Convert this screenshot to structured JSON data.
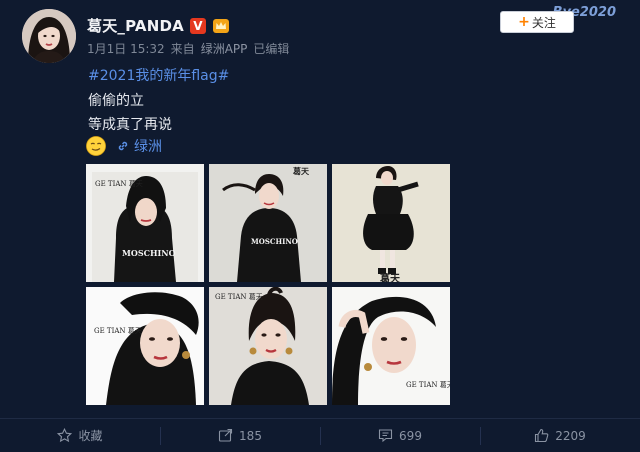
{
  "post": {
    "username": "葛天_PANDA",
    "vip_badge": "V",
    "meta": {
      "time": "1月1日 15:32",
      "source_prefix": "来自",
      "source": "绿洲APP",
      "edited": "已编辑"
    },
    "follow_label": "关注",
    "corner_deco_text": "Bye2020",
    "hashtag": "#2021我的新年flag#",
    "lines": [
      "偷偷的立",
      "等成真了再说"
    ],
    "link_label": "绿洲",
    "photos": [
      {
        "caption": "GE TIAN 葛天",
        "shirt": "MOSCHINO"
      },
      {
        "caption": "葛天",
        "shirt": "MOSCHINO"
      },
      {
        "caption": "葛天",
        "shirt": ""
      },
      {
        "caption": "GE TIAN 葛天",
        "shirt": ""
      },
      {
        "caption": "GE TIAN 葛天",
        "shirt": ""
      },
      {
        "caption": "GE TIAN 葛天",
        "shirt": ""
      }
    ]
  },
  "footer": {
    "favorite_label": "收藏",
    "repost_count": "185",
    "comment_count": "699",
    "like_count": "2209"
  },
  "colors": {
    "background": "#0f1a2f",
    "link": "#5a8fe6",
    "accent_orange": "#ff8200"
  }
}
